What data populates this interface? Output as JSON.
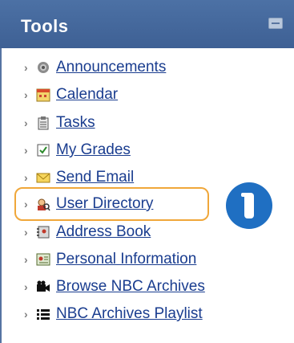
{
  "panel": {
    "title": "Tools"
  },
  "tools": [
    {
      "label": "Announcements",
      "icon": "megaphone-icon"
    },
    {
      "label": "Calendar",
      "icon": "calendar-icon"
    },
    {
      "label": "Tasks",
      "icon": "clipboard-icon"
    },
    {
      "label": "My Grades",
      "icon": "grades-icon"
    },
    {
      "label": "Send Email",
      "icon": "envelope-icon"
    },
    {
      "label": "User Directory",
      "icon": "user-directory-icon"
    },
    {
      "label": "Address Book",
      "icon": "address-book-icon"
    },
    {
      "label": "Personal Information",
      "icon": "personal-info-icon"
    },
    {
      "label": "Browse NBC Archives",
      "icon": "camera-icon"
    },
    {
      "label": "NBC Archives Playlist",
      "icon": "playlist-icon"
    }
  ],
  "highlighted_item": "User Directory",
  "callout": {
    "icon": "info-icon"
  },
  "colors": {
    "header_bg": "#4c71a5",
    "link": "#1a3d8f",
    "highlight_border": "#f0a73a",
    "callout_bg": "#1f6fc2"
  }
}
